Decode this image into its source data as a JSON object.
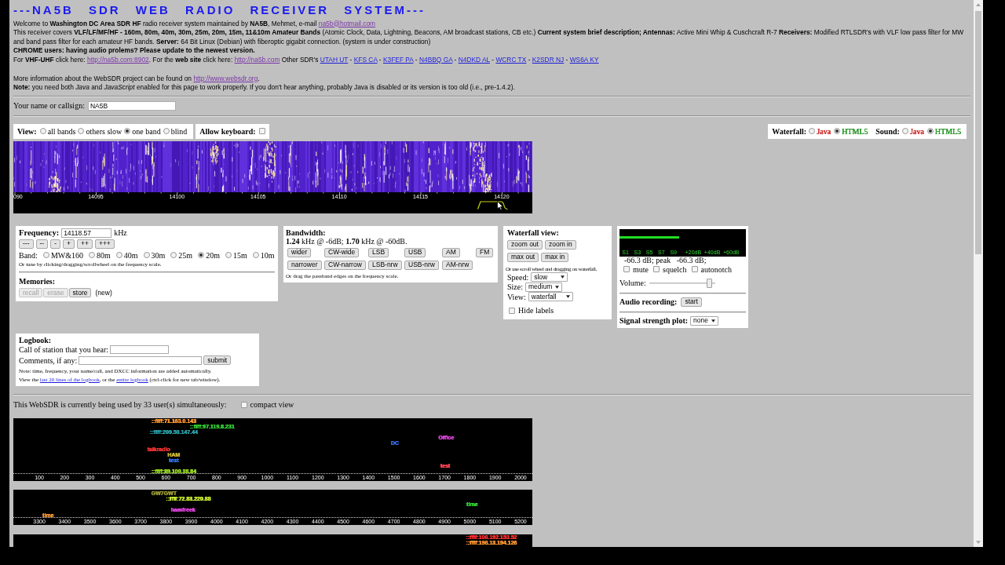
{
  "title": "---NA5B SDR WEB RADIO RECEIVER SYSTEM---",
  "intro": {
    "welcome": [
      {
        "kind": "text",
        "text": "Welcome to **Washington DC Area SDR HF** radio receiver system maintained by **NA5B**, Mehmet, e-mail "
      },
      {
        "kind": "link",
        "text": "na5b@hotmail.com",
        "visited": true
      }
    ],
    "coverage": "This receiver covers **VLF/LF/MF/HF - 160m, 80m, 40m, 30m, 25m, 20m, 15m, 11&10m Amateur Bands** (Atomic Clock, Data, Lightning, Beacons, AM broadcast stations, CB etc.) **Current system brief description; Antennas:** Active Mini Whip & Cuschcraft R-7 **Receivers:** Modified RTLSDR's with VLF low pass filter for MW and band pass filter for each amateur HF bands. **Server:** 64 Bit Linux (Debian) with fiberoptic gigabit connection. (system is under construction)",
    "chrome_notice": "CHROME users: having audio prolems? Please update to the newest version.",
    "links_line": [
      {
        "kind": "text",
        "text": "For **VHF-UHF** click here: "
      },
      {
        "kind": "link",
        "text": "http://na5b.com:8902",
        "visited": true
      },
      {
        "kind": "text",
        "text": ". For the **web site** click here: "
      },
      {
        "kind": "link",
        "text": "http://na5b.com",
        "visited": true
      },
      {
        "kind": "text",
        "text": " Other SDR's "
      },
      {
        "kind": "link",
        "text": "UTAH UT",
        "visited": false
      },
      {
        "kind": "text",
        "text": " - "
      },
      {
        "kind": "link",
        "text": "KFS CA",
        "visited": false
      },
      {
        "kind": "text",
        "text": " - "
      },
      {
        "kind": "link",
        "text": "K3FEF PA",
        "visited": false
      },
      {
        "kind": "text",
        "text": " - "
      },
      {
        "kind": "link",
        "text": "N4BBQ GA",
        "visited": false
      },
      {
        "kind": "text",
        "text": " - "
      },
      {
        "kind": "link",
        "text": "N4DKD AL",
        "visited": false
      },
      {
        "kind": "text",
        "text": " - "
      },
      {
        "kind": "link",
        "text": "WCRC TX",
        "visited": false
      },
      {
        "kind": "text",
        "text": " - "
      },
      {
        "kind": "link",
        "text": "K2SDR NJ",
        "visited": false
      },
      {
        "kind": "text",
        "text": " - "
      },
      {
        "kind": "link",
        "text": "WS6A KY",
        "visited": false
      }
    ],
    "websdr_info": [
      {
        "kind": "text",
        "text": "More information about the WebSDR project can be found on "
      },
      {
        "kind": "link",
        "text": "http://www.websdr.org",
        "visited": true
      },
      {
        "kind": "text",
        "text": "."
      }
    ],
    "note": "**Note:** you need both *Java* and *JavaScript* enabled for this page to work properly. If you don't hear anything, probably Java is disabled or its version is too old (i.e., pre-1.4.2)."
  },
  "callsign": {
    "label": "Your name or callsign:",
    "value": "NA5B"
  },
  "view": {
    "label": "View:",
    "options": [
      {
        "label": "all bands",
        "selected": false
      },
      {
        "label": "others slow",
        "selected": false
      },
      {
        "label": "one band",
        "selected": true
      },
      {
        "label": "blind",
        "selected": false
      }
    ]
  },
  "keyboard": {
    "label": "Allow keyboard:",
    "checked": false
  },
  "engines": [
    {
      "label": "Waterfall:",
      "options": [
        {
          "label": "Java",
          "selected": false,
          "color": "#cc3333"
        },
        {
          "label": "HTML5",
          "selected": true,
          "color": "#339933"
        }
      ]
    },
    {
      "label": "Sound:",
      "options": [
        {
          "label": "Java",
          "selected": false,
          "color": "#cc3333"
        },
        {
          "label": "HTML5",
          "selected": true,
          "color": "#339933"
        }
      ]
    }
  ],
  "waterfall": {
    "scale_labels": [
      "090",
      "14095",
      "14100",
      "14105",
      "14110",
      "14115",
      "14120"
    ]
  },
  "frequency": {
    "label": "Frequency:",
    "value": "14118.57",
    "unit": "kHz",
    "steps": [
      "---",
      "--",
      "-",
      "+",
      "++",
      "+++"
    ],
    "band_label": "Band:",
    "bands": [
      {
        "label": "MW&160",
        "selected": false
      },
      {
        "label": "80m",
        "selected": false
      },
      {
        "label": "40m",
        "selected": false
      },
      {
        "label": "30m",
        "selected": false
      },
      {
        "label": "25m",
        "selected": false
      },
      {
        "label": "20m",
        "selected": true
      },
      {
        "label": "15m",
        "selected": false
      },
      {
        "label": "10m",
        "selected": false
      }
    ],
    "hint": "Or tune by clicking/dragging/scrollwheel on the frequency scale."
  },
  "memories": {
    "label": "Memories:",
    "buttons": [
      {
        "label": "recall",
        "disabled": true
      },
      {
        "label": "erase",
        "disabled": true
      },
      {
        "label": "store",
        "disabled": false
      }
    ],
    "status": "(new)"
  },
  "bandwidth": {
    "label": "Bandwidth:",
    "reading": "**1.24** kHz @ -6dB; **1.70** kHz @ -60dB.",
    "rows": [
      [
        "wider",
        "CW-wide",
        "LSB",
        "USB",
        "AM",
        "FM"
      ],
      [
        "narrower",
        "CW-narrow",
        "LSB-nrw",
        "USB-nrw",
        "AM-nrw"
      ]
    ],
    "hint": "Or drag the passband edges on the frequency scale."
  },
  "waterfall_view": {
    "label": "Waterfall view:",
    "rows": [
      [
        "zoom out",
        "zoom in"
      ],
      [
        "max out",
        "max in"
      ]
    ],
    "hint": "Or use scroll wheel and dragging on waterfall.",
    "selects": [
      {
        "label": "Speed:",
        "value": "slow"
      },
      {
        "label": "Size:",
        "value": "medium"
      },
      {
        "label": "View:",
        "value": "waterfall"
      }
    ],
    "hide_labels": {
      "label": "Hide labels",
      "checked": false
    }
  },
  "audio": {
    "level": 0.47,
    "scale": [
      "S1",
      "S3",
      "S5",
      "S7",
      "S9",
      "+20dB",
      "+40dB",
      "+60dB"
    ],
    "reading": "-66.3 dB; peak   -66.3 dB;",
    "toggles": [
      {
        "label": "mute",
        "checked": false
      },
      {
        "label": "squelch",
        "checked": false
      },
      {
        "label": "autonotch",
        "checked": false
      }
    ],
    "volume": {
      "label": "Volume:",
      "level": 0.95
    },
    "recording": {
      "label": "Audio recording:",
      "button": "start"
    },
    "plot": {
      "label": "Signal strength plot:",
      "value": "none"
    }
  },
  "logbook": {
    "title": "Logbook:",
    "call_label": "Call of station that you hear:",
    "comments_label": "Comments, if any:",
    "submit": "submit",
    "note": "Note: time, frequency, your name/call, and DXCC information are added automatically.",
    "view_line": [
      {
        "kind": "text",
        "text": "View the "
      },
      {
        "kind": "link",
        "text": "last 20 lines of the logbook",
        "visited": false
      },
      {
        "kind": "text",
        "text": ", or the "
      },
      {
        "kind": "link",
        "text": "entire logbook",
        "visited": false
      },
      {
        "kind": "text",
        "text": " (ctrl-click for new tab/window)."
      }
    ]
  },
  "users": {
    "text": "This WebSDR is currently being used by 33 user(s) simultaneously:",
    "compact_view": {
      "label": "compact view",
      "checked": false
    }
  },
  "user_maps": [
    {
      "users": [
        {
          "name": "::ffff:71.163.0.143",
          "color": "#ff9933"
        },
        {
          "name": "::ffff:97.119.8.231",
          "color": "#33cc33"
        },
        {
          "name": "::ffff:209.58.147.44",
          "color": "#2a9fa8"
        },
        {
          "name": "Office",
          "color": "#dd44dd"
        },
        {
          "name": "DC",
          "color": "#3366dd"
        },
        {
          "name": "talkradio",
          "color": "#ee3333"
        },
        {
          "name": "HAM",
          "color": "#c8b432"
        },
        {
          "name": "test",
          "color": "#3377ff"
        },
        {
          "name": "test",
          "color": "#ff4455"
        },
        {
          "name": "::ffff:89.109.38.84",
          "color": "#99dd22"
        }
      ],
      "ticks": [
        "100",
        "200",
        "300",
        "400",
        "500",
        "600",
        "700",
        "800",
        "900",
        "1000",
        "1100",
        "1200",
        "1300",
        "1400",
        "1500",
        "1600",
        "1700",
        "1800",
        "1900",
        "2000"
      ]
    },
    {
      "users": [
        {
          "name": "GW7GWT",
          "color": "#999933"
        },
        {
          "name": "::ffff:72.83.220.88",
          "color": "#ccee33"
        },
        {
          "name": "time",
          "color": "#33dd33"
        },
        {
          "name": "hamfreek",
          "color": "#dd44dd"
        },
        {
          "name": "time",
          "color": "#ff9933"
        }
      ],
      "ticks": [
        "3300",
        "3400",
        "3500",
        "3600",
        "3700",
        "3800",
        "3900",
        "4000",
        "4100",
        "4200",
        "4300",
        "4400",
        "4500",
        "4600",
        "4700",
        "4800",
        "4900",
        "5000",
        "5100",
        "5200"
      ]
    },
    {
      "users": [
        {
          "name": "::ffff:108.192.153.52",
          "color": "#ff3333"
        },
        {
          "name": "::ffff:198.13.194.126",
          "color": "#ff9933"
        }
      ]
    }
  ]
}
